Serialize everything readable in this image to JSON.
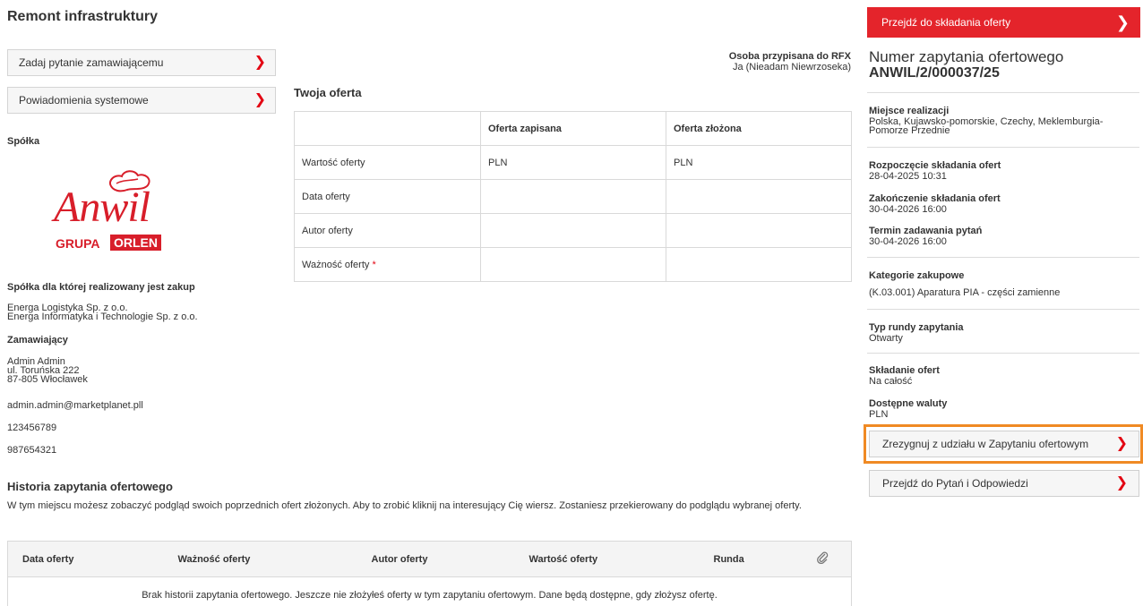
{
  "page": {
    "title": "Remont infrastruktury"
  },
  "left": {
    "ask_button": "Zadaj pytanie zamawiającemu",
    "notifications_button": "Powiadomienia systemowe",
    "company_label": "Spółka",
    "logo": {
      "word": "Anwil",
      "grupa": "GRUPA",
      "orlen": "ORLEN"
    },
    "for_company_label": "Spółka dla której realizowany jest zakup",
    "for_company_lines": [
      "Energa Logistyka Sp. z o.o.",
      "Energa Informatyka i Technologie Sp. z o.o."
    ],
    "ordering_label": "Zamawiający",
    "ordering_lines": [
      "Admin Admin",
      "ul. Toruńska 222",
      "87-805 Włocławek"
    ],
    "email": "admin.admin@marketplanet.pll",
    "phone1": "123456789",
    "phone2": "987654321"
  },
  "rfx_person": {
    "title": "Osoba przypisana do RFX",
    "name": "Ja (Nieadam Niewrzoseka)"
  },
  "offer": {
    "title": "Twoja oferta",
    "headers": [
      "",
      "Oferta zapisana",
      "Oferta złożona"
    ],
    "rows": [
      {
        "label": "Wartość oferty",
        "saved": "PLN",
        "submitted": "PLN"
      },
      {
        "label": "Data oferty",
        "saved": "",
        "submitted": ""
      },
      {
        "label": "Autor oferty",
        "saved": "",
        "submitted": ""
      },
      {
        "label": "Ważność oferty",
        "saved": "",
        "submitted": ""
      }
    ],
    "required_mark": "*"
  },
  "history": {
    "title": "Historia zapytania ofertowego",
    "description": "W tym miejscu możesz zobaczyć podgląd swoich poprzednich ofert złożonych. Aby to zrobić kliknij na interesujący Cię wiersz. Zostaniesz przekierowany do podglądu wybranej oferty.",
    "headers": [
      "Data oferty",
      "Ważność oferty",
      "Autor oferty",
      "Wartość oferty",
      "Runda"
    ],
    "empty": "Brak historii zapytania ofertowego. Jeszcze nie złożyłeś oferty w tym zapytaniu ofertowym. Dane będą dostępne, gdy złożysz ofertę."
  },
  "right": {
    "submit_button": "Przejdź do składania oferty",
    "title": "Numer zapytania ofertowego",
    "number": "ANWIL/2/000037/25",
    "location_label": "Miejsce realizacji",
    "location_lines": [
      "Polska, Kujawsko-pomorskie, Czechy, Meklemburgia-",
      "Pomorze Przednie"
    ],
    "start_label": "Rozpoczęcie składania ofert",
    "start_value": "28-04-2025 10:31",
    "end_label": "Zakończenie składania ofert",
    "end_value": "30-04-2026 16:00",
    "questions_label": "Termin zadawania pytań",
    "questions_value": "30-04-2026 16:00",
    "categories_label": "Kategorie zakupowe",
    "categories_value": "(K.03.001) Aparatura PIA - części zamienne",
    "round_label": "Typ rundy zapytania",
    "round_value": "Otwarty",
    "submission_label": "Składanie ofert",
    "submission_value": "Na całość",
    "currency_label": "Dostępne waluty",
    "currency_value": "PLN",
    "resign_button": "Zrezygnuj z udziału w Zapytaniu ofertowym",
    "qa_button": "Przejdź do Pytań i Odpowiedzi"
  },
  "colors": {
    "accent": "#e4242b",
    "highlight": "#f08a24",
    "logo_red": "#d81e2a"
  }
}
